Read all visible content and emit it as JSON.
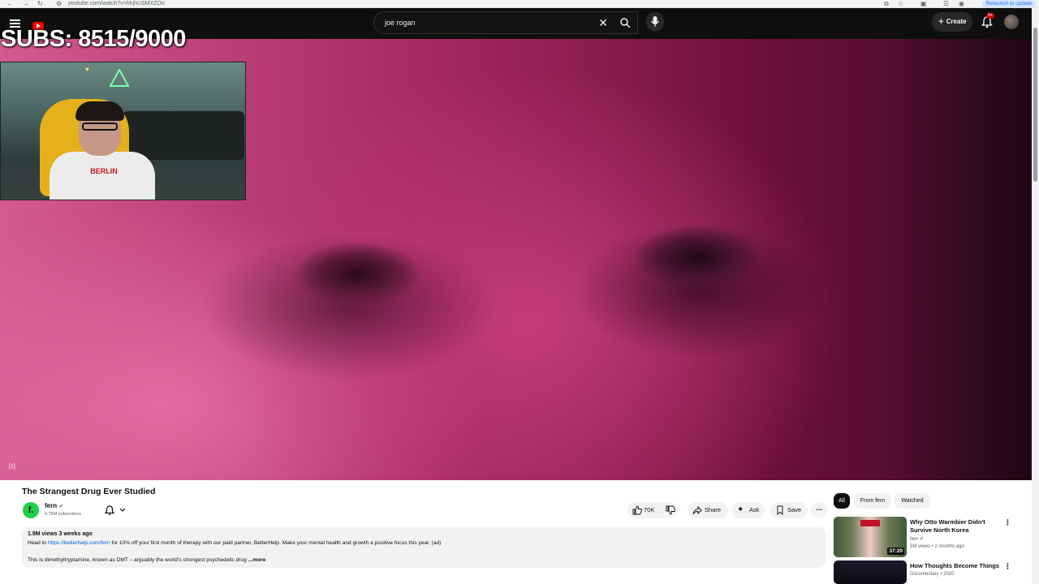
{
  "browser": {
    "url": "youtube.com/watch?v=hhjhUSMXZOo",
    "relaunch_label": "Relaunch to update"
  },
  "header": {
    "search_query": "joe rogan",
    "create_label": "Create",
    "notification_badge": "9+"
  },
  "overlay": {
    "subs_text": "SUBS: 8515/9000",
    "webcam_shirt_text": "BERLIN"
  },
  "video": {
    "marker": "[1]",
    "title": "The Strangest Drug Ever Studied"
  },
  "channel": {
    "avatar_letter": "f.",
    "name": "fern",
    "subscribers": "4.75M subscribers"
  },
  "actions": {
    "like_count": "70K",
    "share_label": "Share",
    "ask_label": "Ask",
    "save_label": "Save"
  },
  "description": {
    "meta": "1.9M views  3 weeks ago",
    "line1_prefix": "Head to ",
    "line1_link": "https://betterhelp.com/fern",
    "line1_suffix": " for 10% off your first month of therapy with our paid partner, BetterHelp. Make your mental health and growth a positive focus this year. (ad)",
    "line2": "This is dimethyltryptamine, known as DMT – arguably the world's strongest psychedelic drug",
    "more_label": "...more"
  },
  "sidebar": {
    "chips": [
      "All",
      "From fern",
      "Watched"
    ],
    "recommendations": [
      {
        "title": "Why Otto Warmbier Didn't Survive North Korea",
        "channel": "fern",
        "meta": "5M views • 2 months ago",
        "duration": "37:20"
      },
      {
        "title": "How Thoughts Become Things",
        "channel": "Documentary • 2020",
        "meta": "",
        "duration": ""
      }
    ]
  },
  "colors": {
    "yt_red": "#ff0000",
    "header_bg": "#0f0f0f",
    "link_blue": "#065fd4",
    "fern_green": "#1fd14a"
  }
}
